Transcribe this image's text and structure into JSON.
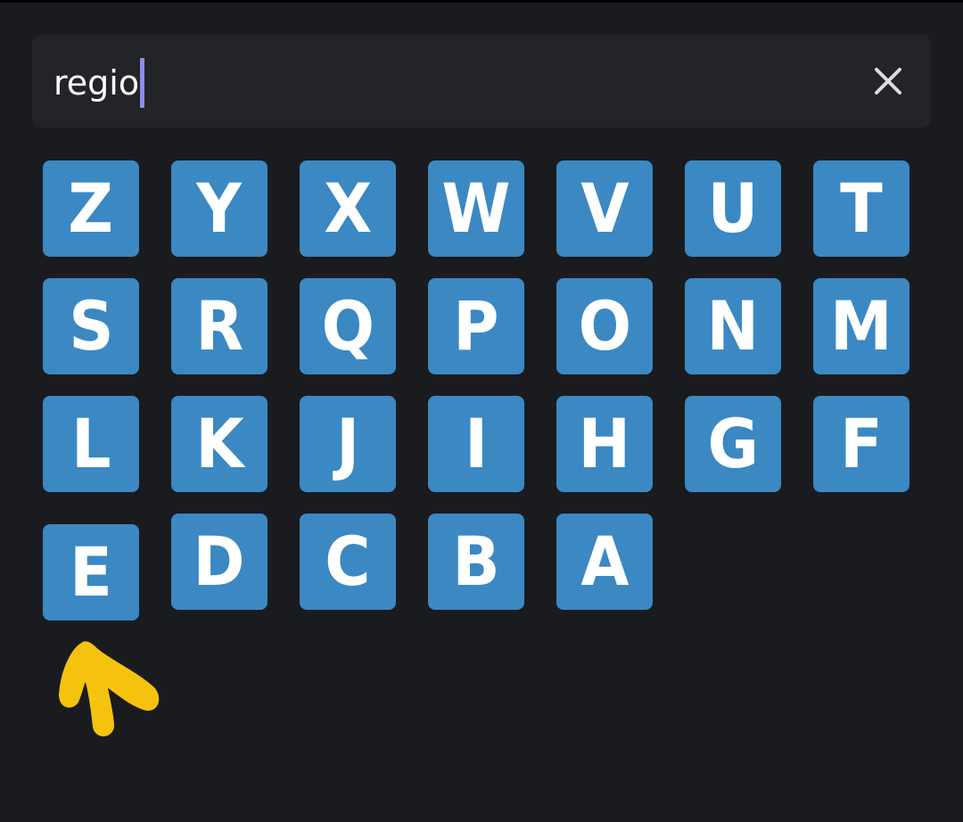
{
  "search": {
    "value": "regio",
    "clear_icon": "close-icon"
  },
  "emoji_grid": {
    "tile_color": "#3b88c3",
    "tiles": [
      "Z",
      "Y",
      "X",
      "W",
      "V",
      "U",
      "T",
      "S",
      "R",
      "Q",
      "P",
      "O",
      "N",
      "M",
      "L",
      "K",
      "J",
      "I",
      "H",
      "G",
      "F",
      "E",
      "D",
      "C",
      "B",
      "A"
    ]
  },
  "annotation": {
    "icon": "yellow-arrow-pointer",
    "color": "#f5c30d"
  }
}
